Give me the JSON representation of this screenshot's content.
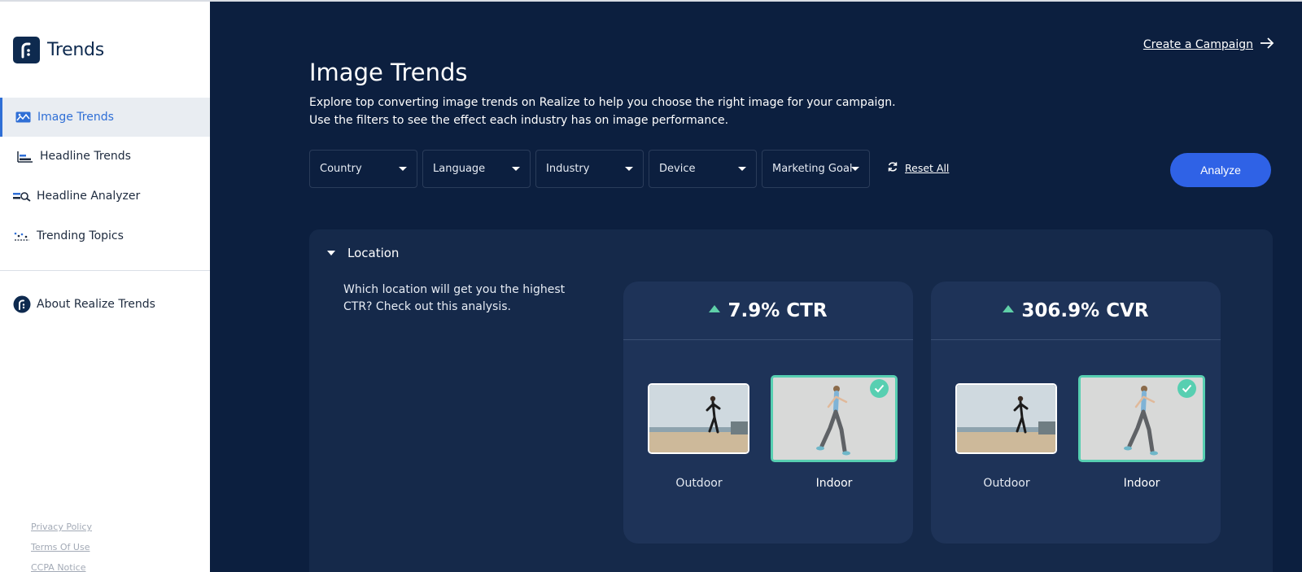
{
  "brand": {
    "name": "Trends"
  },
  "sidebar": {
    "items": [
      {
        "label": "Image Trends",
        "icon": "image-icon",
        "active": true
      },
      {
        "label": "Headline Trends",
        "icon": "bar-chart-icon"
      },
      {
        "label": "Headline Analyzer",
        "icon": "analyzer-icon"
      },
      {
        "label": "Trending Topics",
        "icon": "trending-icon"
      }
    ],
    "about": {
      "label": "About Realize Trends",
      "icon": "realize-logo-icon"
    },
    "footer": [
      "Privacy Policy",
      "Terms Of Use",
      "CCPA Notice"
    ]
  },
  "header": {
    "create_campaign": "Create a Campaign",
    "title": "Image Trends",
    "description_line1": "Explore top converting image trends on Realize to help you choose the right image for your campaign.",
    "description_line2": "Use the filters to see the effect each industry has on image performance."
  },
  "filters": [
    "Country",
    "Language",
    "Industry",
    "Device",
    "Marketing Goal"
  ],
  "reset_label": "Reset All",
  "analyze_label": "Analyze",
  "panel": {
    "title": "Location",
    "question": "Which location will get you the highest CTR? Check out this analysis.",
    "cards": [
      {
        "metric": "7.9% CTR",
        "left_label": "Outdoor",
        "right_label": "Indoor",
        "winner": "Indoor"
      },
      {
        "metric": "306.9% CVR",
        "left_label": "Outdoor",
        "right_label": "Indoor",
        "winner": "Indoor"
      }
    ]
  },
  "colors": {
    "accent": "#2f62e6",
    "success": "#57cfb1",
    "background": "#0c1f3f",
    "card": "#1e3358"
  }
}
